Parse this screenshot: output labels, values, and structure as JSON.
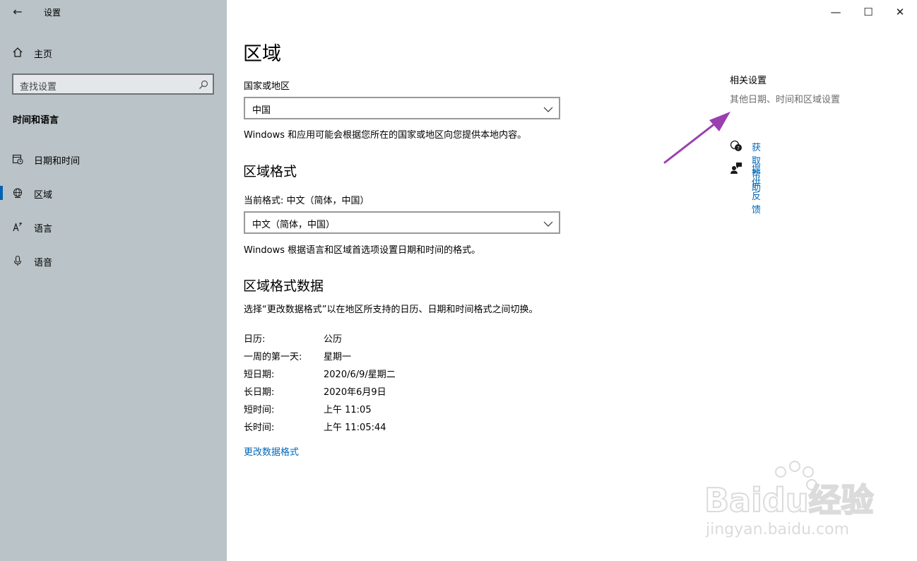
{
  "window": {
    "app_title": "设置",
    "controls": {
      "minimize": "—",
      "maximize": "☐",
      "close": "✕"
    }
  },
  "sidebar": {
    "home": "主页",
    "search_placeholder": "查找设置",
    "group_title": "时间和语言",
    "items": [
      {
        "label": "日期和时间",
        "icon": "calendar-clock-icon"
      },
      {
        "label": "区域",
        "icon": "globe-icon",
        "active": true
      },
      {
        "label": "语言",
        "icon": "language-icon"
      },
      {
        "label": "语音",
        "icon": "microphone-icon"
      }
    ],
    "accent_color": "#0063b1"
  },
  "main": {
    "page_title": "区域",
    "country": {
      "label": "国家或地区",
      "value": "中国",
      "description": "Windows 和应用可能会根据您所在的国家或地区向您提供本地内容。"
    },
    "format": {
      "heading": "区域格式",
      "current_label": "当前格式: 中文（简体，中国）",
      "value": "中文（简体，中国）",
      "description": "Windows 根据语言和区域首选项设置日期和时间的格式。"
    },
    "format_data": {
      "heading": "区域格式数据",
      "description": "选择“更改数据格式”以在地区所支持的日历、日期和时间格式之间切换。",
      "rows": [
        {
          "label": "日历:",
          "value": "公历"
        },
        {
          "label": "一周的第一天:",
          "value": "星期一"
        },
        {
          "label": "短日期:",
          "value": "2020/6/9/星期二"
        },
        {
          "label": "长日期:",
          "value": "2020年6月9日"
        },
        {
          "label": "短时间:",
          "value": "上午 11:05"
        },
        {
          "label": "长时间:",
          "value": "上午 11:05:44"
        }
      ],
      "change_link": "更改数据格式"
    }
  },
  "related": {
    "title": "相关设置",
    "link": "其他日期、时间和区域设置",
    "help": "获取帮助",
    "feedback": "提供反馈",
    "link_color": "#0067b8",
    "arrow_color": "#9a3fb0"
  },
  "watermark": {
    "brand": "Baidu经验",
    "url": "jingyan.baidu.com"
  }
}
